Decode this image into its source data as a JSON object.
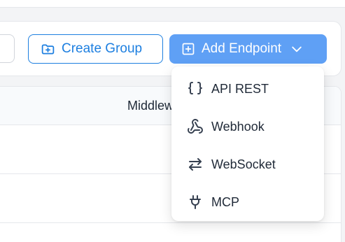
{
  "toolbar": {
    "create_group_label": "Create Group",
    "add_endpoint_label": "Add Endpoint"
  },
  "table": {
    "visible_header": "Middlew"
  },
  "menu": {
    "items": [
      {
        "label": "API REST",
        "icon": "braces-icon"
      },
      {
        "label": "Webhook",
        "icon": "webhook-icon"
      },
      {
        "label": "WebSocket",
        "icon": "arrows-swap-icon"
      },
      {
        "label": "MCP",
        "icon": "plug-icon"
      }
    ]
  },
  "colors": {
    "accent": "#1d7fe0",
    "primary_button": "#5fa0f5",
    "text": "#1f2937"
  }
}
